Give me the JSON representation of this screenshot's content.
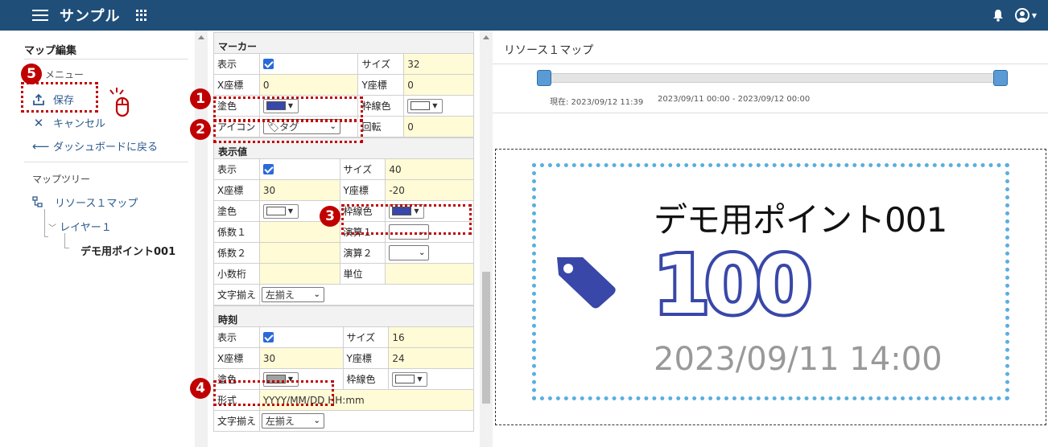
{
  "app": {
    "title": "サンプル"
  },
  "sidebar": {
    "heading": "マップ編集",
    "menu_label": "メニュー",
    "actions": {
      "save": "保存",
      "cancel": "キャンセル",
      "back": "ダッシュボードに戻る"
    },
    "tree_label": "マップツリー",
    "tree": {
      "map": "リソース１マップ",
      "layer": "レイヤー１",
      "point": "デモ用ポイント001"
    }
  },
  "props": {
    "marker": {
      "title": "マーカー",
      "show_label": "表示",
      "size_label": "サイズ",
      "size": "32",
      "x_label": "X座標",
      "x": "0",
      "y_label": "Y座標",
      "y": "0",
      "fill_label": "塗色",
      "fill_color": "#3847a8",
      "stroke_label": "枠線色",
      "stroke_color": "#ffffff",
      "icon_label": "アイコン",
      "icon_value": "タグ",
      "rotate_label": "回転",
      "rotate": "0"
    },
    "value": {
      "title": "表示値",
      "show_label": "表示",
      "size_label": "サイズ",
      "size": "40",
      "x_label": "X座標",
      "x": "30",
      "y_label": "Y座標",
      "y": "-20",
      "fill_label": "塗色",
      "fill_color": "#ffffff",
      "stroke_label": "枠線色",
      "stroke_color": "#3847a8",
      "coef1_label": "係数１",
      "op1_label": "演算１",
      "coef2_label": "係数２",
      "op2_label": "演算２",
      "decimal_label": "小数桁",
      "unit_label": "単位",
      "align_label": "文字揃え",
      "align_value": "左揃え"
    },
    "time": {
      "title": "時刻",
      "show_label": "表示",
      "size_label": "サイズ",
      "size": "16",
      "x_label": "X座標",
      "x": "30",
      "y_label": "Y座標",
      "y": "24",
      "fill_label": "塗色",
      "fill_color": "#a0a0a0",
      "stroke_label": "枠線色",
      "stroke_color": "#ffffff",
      "format_label": "形式",
      "format": "YYYY/MM/DD HH:mm",
      "align_label": "文字揃え",
      "align_value": "左揃え"
    }
  },
  "preview": {
    "title": "リソース１マップ",
    "current": "現在: 2023/09/12 11:39",
    "range": "2023/09/11 00:00 - 2023/09/12 00:00",
    "point_name": "デモ用ポイント001",
    "value": "100",
    "time": "2023/09/11 14:00"
  },
  "annotations": [
    "1",
    "2",
    "3",
    "4",
    "5"
  ]
}
